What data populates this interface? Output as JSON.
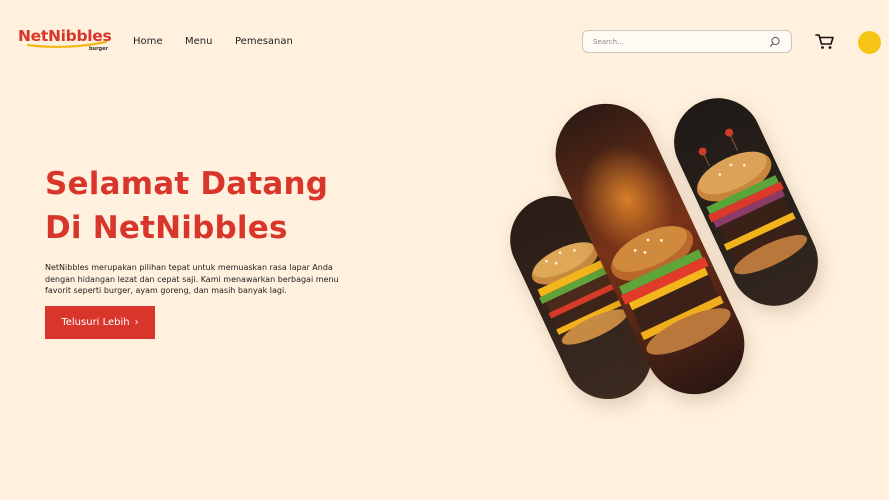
{
  "brand": {
    "name": "NetNibbles",
    "sub": "burger"
  },
  "nav": {
    "items": [
      "Home",
      "Menu",
      "Pemesanan"
    ]
  },
  "search": {
    "placeholder": "Search..."
  },
  "hero": {
    "title_line1": "Selamat Datang",
    "title_line2": "Di NetNibbles",
    "description": "NetNibbles merupakan pilihan tepat untuk memuaskan rasa lapar Anda dengan hidangan lezat dan cepat saji. Kami menawarkan berbagai menu favorit seperti burger, ayam goreng, dan masih banyak lagi.",
    "cta_label": "Telusuri Lebih",
    "cta_chevron": "›"
  },
  "colors": {
    "background": "#fff1de",
    "primary": "#d9362b",
    "avatar": "#f7c516"
  },
  "icons": [
    "search-icon",
    "cart-icon",
    "chevron-right-icon"
  ]
}
